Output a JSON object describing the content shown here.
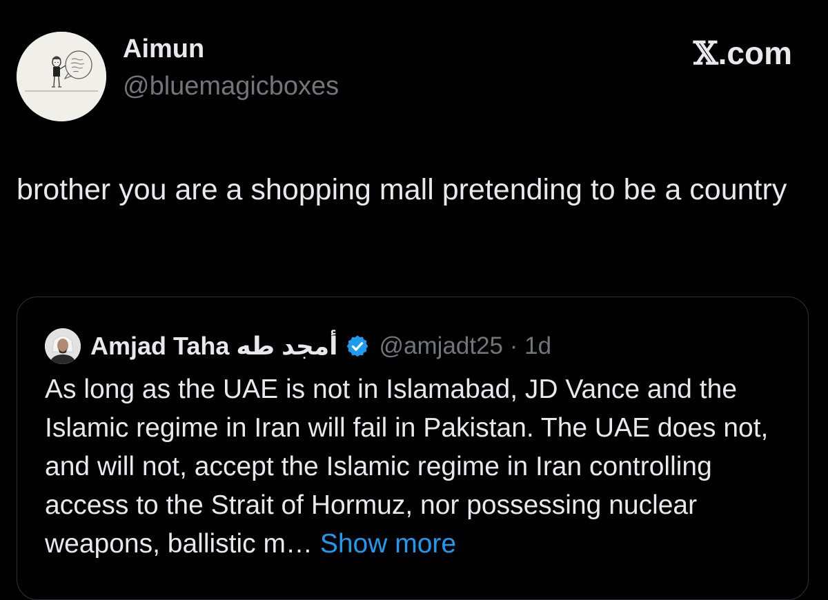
{
  "tweet": {
    "author_name": "Aimun",
    "author_handle": "@bluemagicboxes",
    "avatar_icon": "doodle-avatar-icon",
    "text": "brother you are a shopping mall pretending to be a country"
  },
  "brand": {
    "x_glyph": "𝕏",
    "label": ".com"
  },
  "quoted": {
    "author_name": "Amjad Taha أمجد طه",
    "verified_icon": "verified-badge-icon",
    "handle_time": "@amjadt25 · 1d",
    "text": "As long as the UAE is not in Islamabad, JD Vance and the Islamic regime in Iran will fail in Pakistan. The UAE does not, and will not, accept the Islamic regime in Iran controlling access to the Strait of Hormuz, nor possessing nuclear weapons, ballistic m…",
    "show_more": "Show more"
  },
  "colors": {
    "background": "#000000",
    "text": "#e7e9ea",
    "secondary_text": "#71767b",
    "link": "#1d9bf0",
    "verified": "#1d9bf0",
    "border": "#2f3336"
  }
}
